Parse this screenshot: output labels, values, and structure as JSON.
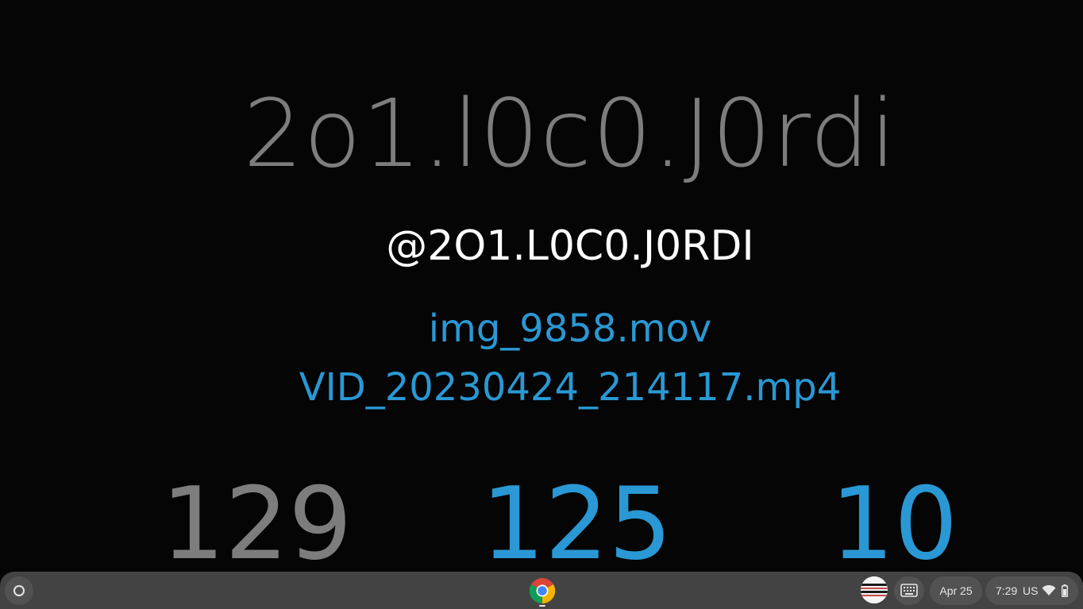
{
  "profile": {
    "display_name": "2o1.l0c0.J0rdi",
    "handle": "@2O1.L0C0.J0RDI",
    "files": [
      "img_9858.mov",
      "VID_20230424_214117.mp4"
    ],
    "stats": [
      "129",
      "125",
      "10"
    ]
  },
  "colors": {
    "background": "#050505",
    "muted_text": "#7d7d7d",
    "accent": "#2a98d4",
    "shelf": "#434343"
  },
  "shelf": {
    "launcher_icon": "launcher-circle-icon",
    "pinned_app_icon": "chrome-icon",
    "avatar_icon": "profile-avatar-icon",
    "keyboard_icon": "keyboard-icon",
    "date": "Apr 25",
    "time": "7:29",
    "input_method": "US",
    "wifi_icon": "wifi-icon",
    "battery_icon": "battery-icon"
  }
}
